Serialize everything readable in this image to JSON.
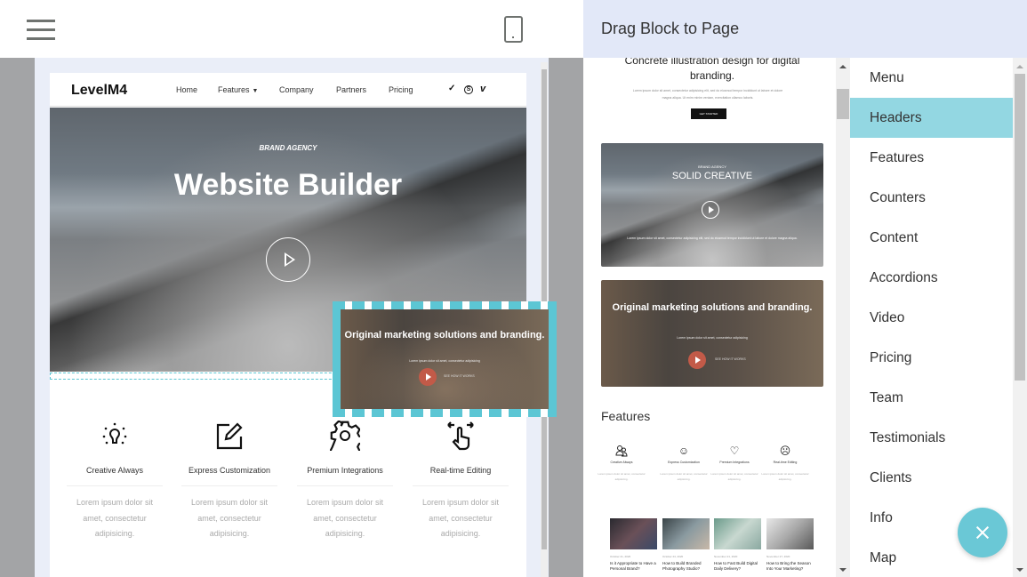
{
  "toolbar": {
    "menu_icon": "hamburger-icon",
    "preview_icon": "mobile-phone-icon"
  },
  "site": {
    "brand": "LevelM4",
    "nav": [
      "Home",
      "Features",
      "Company",
      "Partners",
      "Pricing"
    ],
    "social": [
      "twitter-icon",
      "skype-icon",
      "vimeo-icon"
    ],
    "social_glyphs": {
      "twitter": "🐦",
      "skype": "S",
      "vimeo": "v"
    },
    "hero": {
      "kicker": "BRAND AGENCY",
      "title": "Website Builder",
      "play_icon": "play-icon"
    },
    "features": [
      {
        "icon": "lightbulb-icon",
        "title": "Creative Always",
        "text": "Lorem ipsum dolor sit amet, consectetur adipisicing."
      },
      {
        "icon": "edit-icon",
        "title": "Express Customization",
        "text": "Lorem ipsum dolor sit amet, consectetur adipisicing."
      },
      {
        "icon": "gear-icon",
        "title": "Premium Integrations",
        "text": "Lorem ipsum dolor sit amet, consectetur adipisicing."
      },
      {
        "icon": "touch-swipe-icon",
        "title": "Real-time Editing",
        "text": "Lorem ipsum dolor sit amet, consectetur adipisicing."
      }
    ]
  },
  "dragged_block": {
    "title": "Original marketing solutions and branding.",
    "subtitle": "Lorem ipsum dolor sit amet, consectetur adipisicing",
    "link": "SEE HOW IT WORKS"
  },
  "panel": {
    "title": "Drag Block to Page",
    "top_block": {
      "title": "Concrete illustration design for digital branding.",
      "text": "Lorem ipsum dolor sit amet, consectetur adipisicing elit, sed do eiusmod tempor incididunt ut labore et dolore magna aliqua. Ut enim minim veniam, exercitation ullamco laboris.",
      "button": "GET STARTED"
    },
    "mountain_block": {
      "kicker": "BRAND AGENCY",
      "title": "SOLID CREATIVE",
      "text": "Lorem ipsum dolor sit amet, consectetur adipisicing elit, sed do eiusmod tempor incididunt ut labore et dolore magna aliqua."
    },
    "office_block": {
      "title": "Original marketing solutions and branding.",
      "subtitle": "Lorem ipsum dolor sit amet, consectetur adipisicing",
      "link": "SEE HOW IT WORKS"
    },
    "features_label": "Features",
    "mini_features": [
      {
        "icon": "users-icon",
        "glyph": "👥",
        "title": "Creative Always",
        "text": "Lorem ipsum dolor sit amet, consectetur adipisicing."
      },
      {
        "icon": "smile-icon",
        "glyph": "☺",
        "title": "Express Customization",
        "text": "Lorem ipsum dolor sit amet, consectetur adipisicing."
      },
      {
        "icon": "heart-icon",
        "glyph": "♡",
        "title": "Premium Integrations",
        "text": "Lorem ipsum dolor sit amet, consectetur adipisicing."
      },
      {
        "icon": "sad-face-icon",
        "glyph": "☹",
        "title": "Real-time Editing",
        "text": "Lorem ipsum dolor sit amet, consectetur adipisicing."
      }
    ],
    "blog_posts": [
      {
        "date": "October 21, 2020",
        "title": "Is it Appropriate to Have a Personal Brand?"
      },
      {
        "date": "October 24, 2020",
        "title": "How to Build Branded Photography Studio?"
      },
      {
        "date": "November 21, 2020",
        "title": "How to Fast Build Digital Daily Delivery?"
      },
      {
        "date": "November 27, 2020",
        "title": "How to Bring the Season Into Your Marketing?"
      }
    ],
    "categories": [
      {
        "label": "Menu",
        "active": false
      },
      {
        "label": "Headers",
        "active": true
      },
      {
        "label": "Features",
        "active": false
      },
      {
        "label": "Counters",
        "active": false
      },
      {
        "label": "Content",
        "active": false
      },
      {
        "label": "Accordions",
        "active": false
      },
      {
        "label": "Video",
        "active": false
      },
      {
        "label": "Pricing",
        "active": false
      },
      {
        "label": "Team",
        "active": false
      },
      {
        "label": "Testimonials",
        "active": false
      },
      {
        "label": "Clients",
        "active": false
      },
      {
        "label": "Info",
        "active": false
      },
      {
        "label": "Map",
        "active": false
      }
    ],
    "close_button_icon": "close-icon"
  },
  "colors": {
    "accent": "#6ac8d6",
    "active_category": "#93d7e2",
    "panel_header": "#e2e8f8",
    "play_button": "#c25a48"
  }
}
